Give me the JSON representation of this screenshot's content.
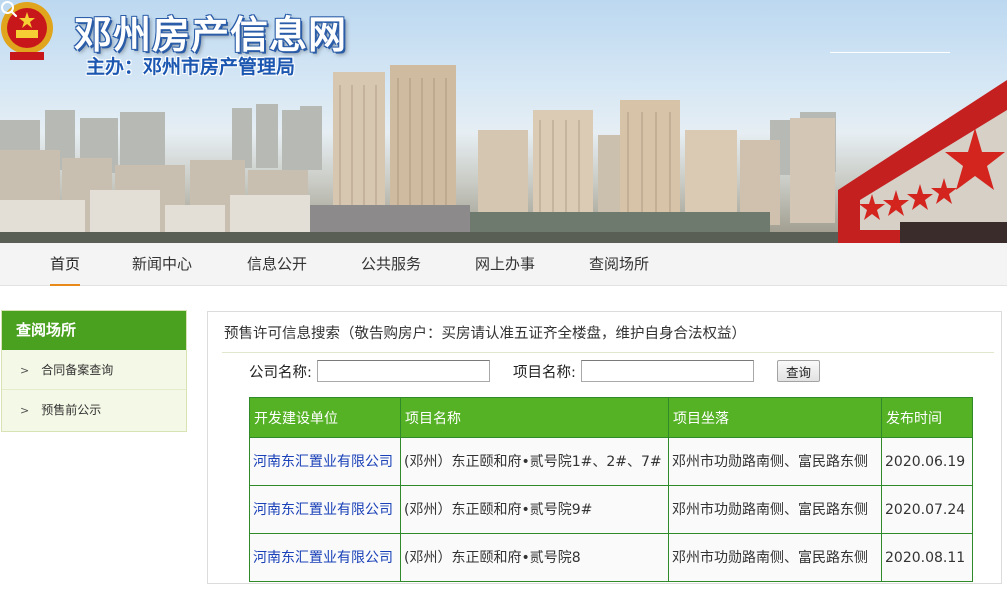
{
  "header": {
    "title": "邓州房产信息网",
    "subtitle": "主办：邓州市房产管理局",
    "search_placeholder": "",
    "search_icon": "search-icon"
  },
  "nav": {
    "items": [
      {
        "label": "首页",
        "active": true
      },
      {
        "label": "新闻中心"
      },
      {
        "label": "信息公开"
      },
      {
        "label": "公共服务"
      },
      {
        "label": "网上办事"
      },
      {
        "label": "查阅场所"
      }
    ]
  },
  "sidebar": {
    "title": "查阅场所",
    "items": [
      {
        "arrow": ">",
        "label": "合同备案查询"
      },
      {
        "arrow": ">",
        "label": "预售前公示"
      }
    ]
  },
  "main": {
    "heading": "预售许可信息搜索（敬告购房户：买房请认准五证齐全楼盘，维护自身合法权益）",
    "form": {
      "company_label": "公司名称:",
      "company_value": "",
      "project_label": "项目名称:",
      "project_value": "",
      "query_label": "查询"
    },
    "table": {
      "headers": [
        "开发建设单位",
        "项目名称",
        "项目坐落",
        "发布时间"
      ],
      "rows": [
        [
          "河南东汇置业有限公司",
          "(邓州）东正颐和府•贰号院1#、2#、7#",
          "邓州市功勋路南侧、富民路东侧",
          "2020.06.19"
        ],
        [
          "河南东汇置业有限公司",
          "(邓州）东正颐和府•贰号院9#",
          "邓州市功勋路南侧、富民路东侧",
          "2020.07.24"
        ],
        [
          "河南东汇置业有限公司",
          "(邓州）东正颐和府•贰号院8",
          "邓州市功勋路南侧、富民路东侧",
          "2020.08.11"
        ]
      ]
    }
  },
  "colors": {
    "accent_green": "#54b224",
    "sidebar_green": "#4aa01f",
    "link_blue": "#1a41b8",
    "nav_active_underline": "#e88a1a",
    "title_blue": "#2a5ca8"
  }
}
